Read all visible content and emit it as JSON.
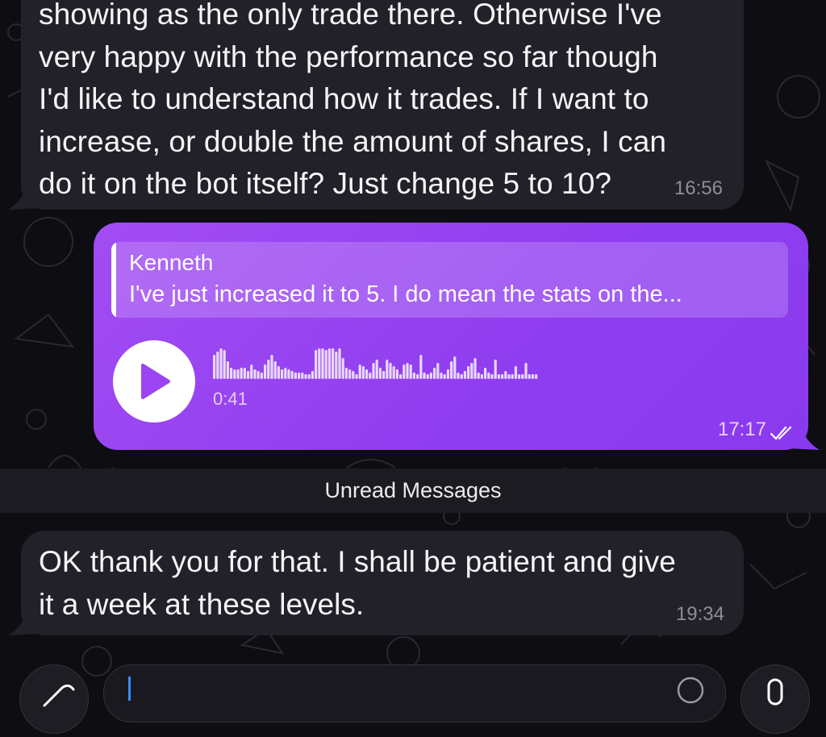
{
  "messages": [
    {
      "id": "msg1",
      "direction": "incoming",
      "lines": [
        "showing as the only trade there. Otherwise I've",
        "very happy with the performance so far though",
        "I'd like to understand how it trades. If I want to",
        "increase, or double the amount of shares, I can",
        "do it on the bot itself? Just change 5 to 10?"
      ],
      "time": "16:56"
    },
    {
      "id": "msg2",
      "direction": "outgoing",
      "type": "voice",
      "reply": {
        "name": "Kenneth",
        "quote": "I've just increased it to 5. I do mean the stats on the..."
      },
      "duration": "0:41",
      "time": "17:17",
      "status": "read"
    },
    {
      "id": "msg3",
      "direction": "incoming",
      "lines": [
        "OK thank you for that. I shall be patient and give",
        "it a week at these levels."
      ],
      "time": "19:34"
    }
  ],
  "divider": {
    "label": "Unread Messages"
  },
  "colors": {
    "background": "#0d0d12",
    "incoming_bubble": "#222129",
    "outgoing_bubble": "#9a45f1",
    "timestamp_in": "#8e8d95",
    "cursor": "#3d8bff"
  },
  "icons": {
    "play": "play-icon",
    "read": "double-check-icon",
    "attach": "paperclip-icon",
    "sticker": "sticker-icon",
    "mic": "microphone-icon"
  }
}
